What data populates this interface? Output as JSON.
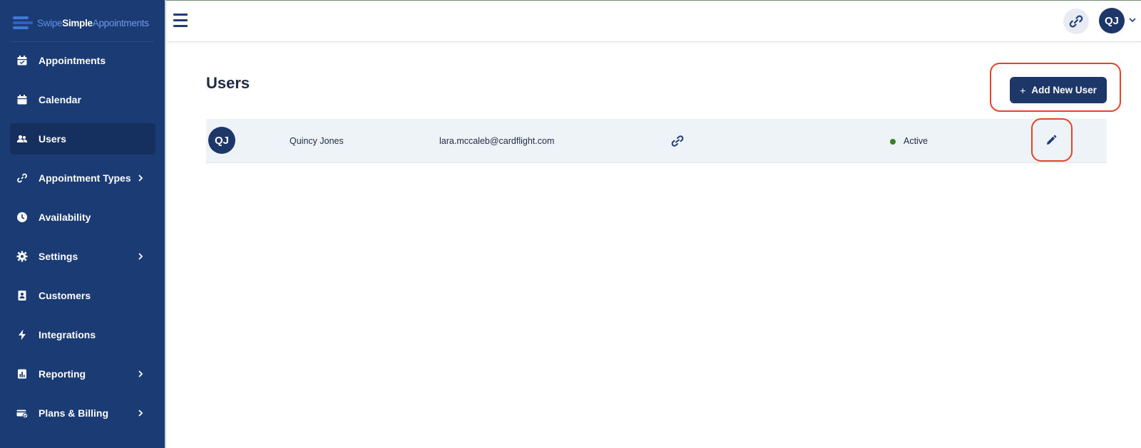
{
  "app": {
    "logo_swipe": "Swipe",
    "logo_simple": "Simple",
    "logo_appointments": "Appointments"
  },
  "sidebar": {
    "items": [
      {
        "label": "Appointments",
        "icon": "calendar-check-icon",
        "active": false,
        "has_submenu": false
      },
      {
        "label": "Calendar",
        "icon": "calendar-icon",
        "active": false,
        "has_submenu": false
      },
      {
        "label": "Users",
        "icon": "users-icon",
        "active": true,
        "has_submenu": false
      },
      {
        "label": "Appointment Types",
        "icon": "link-icon",
        "active": false,
        "has_submenu": true
      },
      {
        "label": "Availability",
        "icon": "clock-icon",
        "active": false,
        "has_submenu": false
      },
      {
        "label": "Settings",
        "icon": "gear-icon",
        "active": false,
        "has_submenu": true
      },
      {
        "label": "Customers",
        "icon": "contact-book-icon",
        "active": false,
        "has_submenu": false
      },
      {
        "label": "Integrations",
        "icon": "bolt-icon",
        "active": false,
        "has_submenu": false
      },
      {
        "label": "Reporting",
        "icon": "report-icon",
        "active": false,
        "has_submenu": true
      },
      {
        "label": "Plans & Billing",
        "icon": "billing-icon",
        "active": false,
        "has_submenu": true
      }
    ]
  },
  "topbar": {
    "menu_icon": "hamburger-icon",
    "link_icon": "link-icon",
    "user_initials": "QJ",
    "dropdown_icon": "chevron-down-icon"
  },
  "main": {
    "title": "Users",
    "add_button_prefix": "+",
    "add_button_label": "Add New User",
    "users": [
      {
        "initials": "QJ",
        "name": "Quincy Jones",
        "email": "lara.mccaleb@cardflight.com",
        "status": "Active",
        "link_icon": "link-icon",
        "edit_icon": "pencil-icon"
      }
    ]
  },
  "colors": {
    "sidebar_bg": "#1a3b73",
    "sidebar_active": "#15305f",
    "primary": "#1c3768",
    "row_bg": "#eef3f7",
    "status_active": "#3a7f2a",
    "highlight": "#e0442a"
  }
}
